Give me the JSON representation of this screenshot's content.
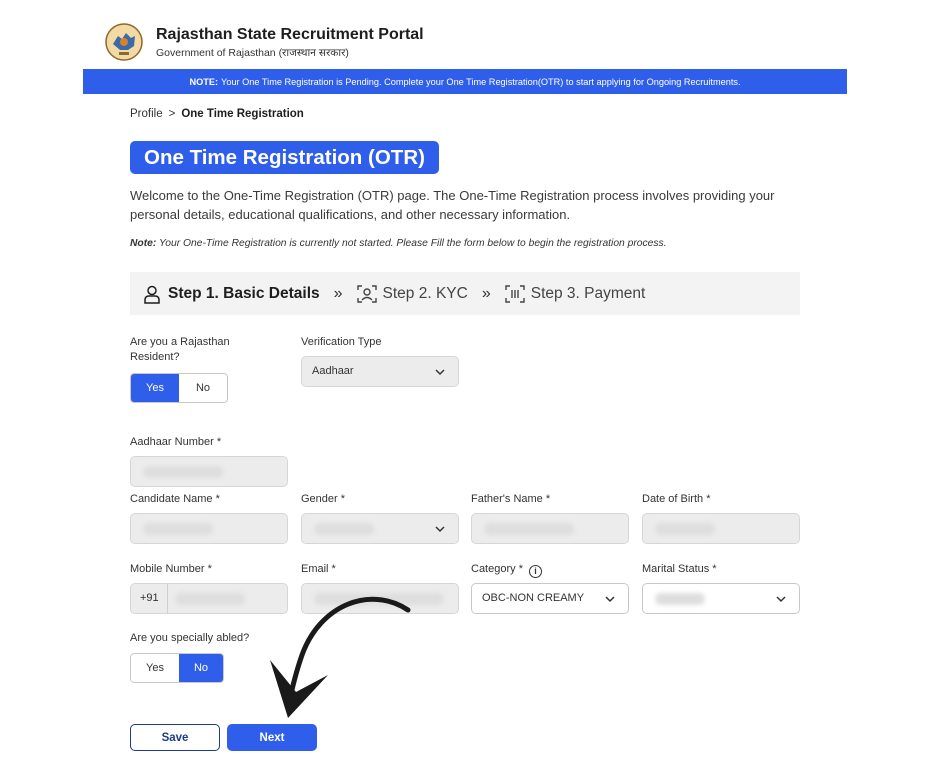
{
  "header": {
    "title": "Rajasthan State Recruitment Portal",
    "subtitle": "Government of Rajasthan (राजस्थान सरकार)"
  },
  "notice": {
    "prefix": "NOTE:",
    "text": "Your One Time Registration is Pending. Complete your One Time Registration(OTR) to start applying for Ongoing Recruitments."
  },
  "breadcrumb": {
    "parent": "Profile",
    "separator": ">",
    "current": "One Time Registration"
  },
  "page": {
    "title": "One Time Registration (OTR)",
    "intro": "Welcome to the One-Time Registration (OTR) page. The One-Time Registration process involves providing your personal details, educational qualifications, and other necessary information.",
    "note_prefix": "Note:",
    "note_text": "Your One-Time Registration is currently not started. Please Fill the form below to begin the registration process."
  },
  "steps": {
    "separator": "»",
    "items": [
      {
        "label": "Step 1. Basic Details",
        "icon": "user-icon",
        "active": true
      },
      {
        "label": "Step 2. KYC",
        "icon": "face-scan-icon",
        "active": false
      },
      {
        "label": "Step 3. Payment",
        "icon": "barcode-scan-icon",
        "active": false
      }
    ]
  },
  "form": {
    "resident": {
      "label": "Are you a Rajasthan Resident?",
      "yes": "Yes",
      "no": "No",
      "selected": "Yes"
    },
    "verification_type": {
      "label": "Verification Type",
      "value": "Aadhaar"
    },
    "aadhaar_number": {
      "label": "Aadhaar Number *"
    },
    "candidate_name": {
      "label": "Candidate Name *"
    },
    "gender": {
      "label": "Gender *"
    },
    "father_name": {
      "label": "Father's Name *"
    },
    "dob": {
      "label": "Date of Birth *"
    },
    "mobile": {
      "label": "Mobile Number *",
      "prefix": "+91"
    },
    "email": {
      "label": "Email *"
    },
    "category": {
      "label": "Category *",
      "value": "OBC-NON CREAMY"
    },
    "marital_status": {
      "label": "Marital Status *"
    },
    "specially_abled": {
      "label": "Are you specially abled?",
      "yes": "Yes",
      "no": "No",
      "selected": "No"
    }
  },
  "buttons": {
    "save": "Save",
    "next": "Next"
  },
  "colors": {
    "primary": "#2f5fea",
    "save_border": "#1e3a8a"
  }
}
